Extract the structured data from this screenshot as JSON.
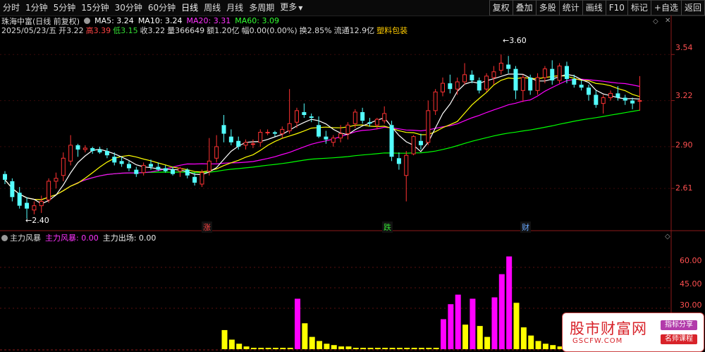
{
  "toolbar": {
    "periods": [
      "分时",
      "1分钟",
      "5分钟",
      "15分钟",
      "30分钟",
      "60分钟",
      "日线",
      "周线",
      "月线",
      "多周期",
      "更多"
    ],
    "active_period": "日线",
    "tools": [
      "复权",
      "叠加",
      "多股",
      "统计",
      "画线",
      "F10",
      "标记",
      "+自选",
      "返回"
    ]
  },
  "stock": {
    "name": "珠海中富(日线 前复权)",
    "ma5_label": "MA5: 3.24",
    "ma10_label": "MA10: 3.24",
    "ma20_label": "MA20: 3.31",
    "ma60_label": "MA60: 3.09",
    "date_label": "2025/05/23/五",
    "open": "开3.22",
    "high_lbl": "高",
    "high": "3.39",
    "low_lbl": "低",
    "low": "3.15",
    "close": "收3.22",
    "volume": "量366649",
    "amount": "额1.20亿",
    "change": "幅0.00(0.00%)",
    "turnover": "换2.85%",
    "float": "流通12.9亿",
    "sector": "塑料包装"
  },
  "price_axis": [
    "3.54",
    "3.22",
    "2.90",
    "2.61"
  ],
  "annotations": {
    "max_label": "3.60",
    "min_label": "2.40"
  },
  "markers": [
    "涨",
    "跌",
    "财"
  ],
  "indicator": {
    "name": "主力风暴",
    "storm_label": "主力风暴: 0.00",
    "exit_label": "主力出场: 0.00",
    "axis": [
      "60.00",
      "45.00",
      "30.00"
    ]
  },
  "watermark": {
    "title": "股市财富网",
    "url": "GSCFW.COM",
    "badge1": "指标分享",
    "badge2": "名师课程"
  },
  "colors": {
    "up": "#ff3232",
    "down": "#54ffff",
    "ma5": "#ffffff",
    "ma10": "#ffff00",
    "ma20": "#ff00ff",
    "ma60": "#00ff00",
    "storm": "#ff00ff",
    "exit": "#ffff00",
    "axis_text": "#ff5050"
  },
  "chart_data": {
    "type": "candlestick",
    "ylim": [
      2.4,
      3.6
    ],
    "candles": [
      {
        "o": 2.71,
        "h": 2.73,
        "l": 2.64,
        "c": 2.67
      },
      {
        "o": 2.66,
        "h": 2.68,
        "l": 2.52,
        "c": 2.55
      },
      {
        "o": 2.58,
        "h": 2.62,
        "l": 2.47,
        "c": 2.49
      },
      {
        "o": 2.51,
        "h": 2.55,
        "l": 2.4,
        "c": 2.47
      },
      {
        "o": 2.46,
        "h": 2.52,
        "l": 2.43,
        "c": 2.49
      },
      {
        "o": 2.49,
        "h": 2.56,
        "l": 2.44,
        "c": 2.52
      },
      {
        "o": 2.53,
        "h": 2.68,
        "l": 2.51,
        "c": 2.66
      },
      {
        "o": 2.66,
        "h": 2.72,
        "l": 2.61,
        "c": 2.68
      },
      {
        "o": 2.7,
        "h": 2.86,
        "l": 2.66,
        "c": 2.82
      },
      {
        "o": 2.8,
        "h": 2.98,
        "l": 2.77,
        "c": 2.91
      },
      {
        "o": 2.91,
        "h": 2.92,
        "l": 2.83,
        "c": 2.88
      },
      {
        "o": 2.88,
        "h": 2.91,
        "l": 2.86,
        "c": 2.89
      },
      {
        "o": 2.89,
        "h": 2.9,
        "l": 2.85,
        "c": 2.87
      },
      {
        "o": 2.88,
        "h": 2.9,
        "l": 2.85,
        "c": 2.86
      },
      {
        "o": 2.87,
        "h": 2.89,
        "l": 2.82,
        "c": 2.84
      },
      {
        "o": 2.83,
        "h": 2.86,
        "l": 2.77,
        "c": 2.79
      },
      {
        "o": 2.8,
        "h": 2.83,
        "l": 2.76,
        "c": 2.78
      },
      {
        "o": 2.78,
        "h": 2.8,
        "l": 2.73,
        "c": 2.75
      },
      {
        "o": 2.74,
        "h": 2.76,
        "l": 2.69,
        "c": 2.71
      },
      {
        "o": 2.72,
        "h": 2.79,
        "l": 2.7,
        "c": 2.77
      },
      {
        "o": 2.78,
        "h": 2.81,
        "l": 2.74,
        "c": 2.76
      },
      {
        "o": 2.76,
        "h": 2.79,
        "l": 2.73,
        "c": 2.74
      },
      {
        "o": 2.75,
        "h": 2.77,
        "l": 2.72,
        "c": 2.73
      },
      {
        "o": 2.74,
        "h": 2.76,
        "l": 2.7,
        "c": 2.71
      },
      {
        "o": 2.73,
        "h": 2.76,
        "l": 2.69,
        "c": 2.75
      },
      {
        "o": 2.74,
        "h": 2.75,
        "l": 2.68,
        "c": 2.7
      },
      {
        "o": 2.69,
        "h": 2.72,
        "l": 2.63,
        "c": 2.65
      },
      {
        "o": 2.64,
        "h": 2.74,
        "l": 2.62,
        "c": 2.72
      },
      {
        "o": 2.73,
        "h": 2.96,
        "l": 2.7,
        "c": 2.8
      },
      {
        "o": 2.82,
        "h": 2.98,
        "l": 2.79,
        "c": 2.9
      },
      {
        "o": 3.05,
        "h": 3.12,
        "l": 2.93,
        "c": 2.99
      },
      {
        "o": 2.97,
        "h": 3.02,
        "l": 2.91,
        "c": 2.93
      },
      {
        "o": 2.94,
        "h": 2.97,
        "l": 2.88,
        "c": 2.9
      },
      {
        "o": 2.91,
        "h": 2.95,
        "l": 2.88,
        "c": 2.93
      },
      {
        "o": 2.92,
        "h": 2.95,
        "l": 2.89,
        "c": 2.92
      },
      {
        "o": 2.93,
        "h": 3.02,
        "l": 2.9,
        "c": 3.0
      },
      {
        "o": 3.0,
        "h": 3.02,
        "l": 2.98,
        "c": 3.0
      },
      {
        "o": 3.0,
        "h": 3.01,
        "l": 2.97,
        "c": 2.99
      },
      {
        "o": 2.99,
        "h": 3.04,
        "l": 2.96,
        "c": 3.02
      },
      {
        "o": 3.01,
        "h": 3.3,
        "l": 2.99,
        "c": 3.06
      },
      {
        "o": 3.07,
        "h": 3.17,
        "l": 3.03,
        "c": 3.15
      },
      {
        "o": 3.14,
        "h": 3.2,
        "l": 3.1,
        "c": 3.12
      },
      {
        "o": 3.11,
        "h": 3.13,
        "l": 3.07,
        "c": 3.1
      },
      {
        "o": 3.05,
        "h": 3.11,
        "l": 2.96,
        "c": 2.97
      },
      {
        "o": 2.97,
        "h": 3.01,
        "l": 2.92,
        "c": 2.95
      },
      {
        "o": 2.93,
        "h": 2.98,
        "l": 2.9,
        "c": 2.96
      },
      {
        "o": 2.96,
        "h": 3.05,
        "l": 2.93,
        "c": 2.99
      },
      {
        "o": 2.99,
        "h": 3.07,
        "l": 2.95,
        "c": 3.05
      },
      {
        "o": 3.06,
        "h": 3.16,
        "l": 3.03,
        "c": 3.14
      },
      {
        "o": 3.14,
        "h": 3.17,
        "l": 3.06,
        "c": 3.08
      },
      {
        "o": 3.07,
        "h": 3.1,
        "l": 3.04,
        "c": 3.06
      },
      {
        "o": 3.05,
        "h": 3.1,
        "l": 3.02,
        "c": 3.09
      },
      {
        "o": 3.08,
        "h": 3.18,
        "l": 3.06,
        "c": 3.13
      },
      {
        "o": 3.05,
        "h": 3.08,
        "l": 2.8,
        "c": 2.83
      },
      {
        "o": 2.82,
        "h": 2.86,
        "l": 2.74,
        "c": 2.78
      },
      {
        "o": 2.7,
        "h": 2.87,
        "l": 2.52,
        "c": 2.84
      },
      {
        "o": 2.85,
        "h": 2.98,
        "l": 2.84,
        "c": 2.97
      },
      {
        "o": 2.94,
        "h": 2.99,
        "l": 2.88,
        "c": 2.91
      },
      {
        "o": 2.93,
        "h": 3.22,
        "l": 2.91,
        "c": 3.15
      },
      {
        "o": 3.15,
        "h": 3.3,
        "l": 3.12,
        "c": 3.28
      },
      {
        "o": 3.28,
        "h": 3.38,
        "l": 3.25,
        "c": 3.34
      },
      {
        "o": 3.34,
        "h": 3.4,
        "l": 3.27,
        "c": 3.3
      },
      {
        "o": 3.3,
        "h": 3.38,
        "l": 3.26,
        "c": 3.35
      },
      {
        "o": 3.35,
        "h": 3.48,
        "l": 3.33,
        "c": 3.4
      },
      {
        "o": 3.4,
        "h": 3.43,
        "l": 3.34,
        "c": 3.36
      },
      {
        "o": 3.36,
        "h": 3.38,
        "l": 3.27,
        "c": 3.29
      },
      {
        "o": 3.3,
        "h": 3.41,
        "l": 3.28,
        "c": 3.39
      },
      {
        "o": 3.38,
        "h": 3.46,
        "l": 3.33,
        "c": 3.42
      },
      {
        "o": 3.43,
        "h": 3.54,
        "l": 3.4,
        "c": 3.48
      },
      {
        "o": 3.47,
        "h": 3.53,
        "l": 3.41,
        "c": 3.44
      },
      {
        "o": 3.44,
        "h": 3.46,
        "l": 3.23,
        "c": 3.29
      },
      {
        "o": 3.29,
        "h": 3.4,
        "l": 3.21,
        "c": 3.38
      },
      {
        "o": 3.38,
        "h": 3.4,
        "l": 3.26,
        "c": 3.29
      },
      {
        "o": 3.29,
        "h": 3.41,
        "l": 3.26,
        "c": 3.38
      },
      {
        "o": 3.38,
        "h": 3.46,
        "l": 3.34,
        "c": 3.44
      },
      {
        "o": 3.44,
        "h": 3.5,
        "l": 3.33,
        "c": 3.36
      },
      {
        "o": 3.36,
        "h": 3.48,
        "l": 3.34,
        "c": 3.46
      },
      {
        "o": 3.46,
        "h": 3.49,
        "l": 3.34,
        "c": 3.37
      },
      {
        "o": 3.37,
        "h": 3.4,
        "l": 3.31,
        "c": 3.33
      },
      {
        "o": 3.33,
        "h": 3.36,
        "l": 3.29,
        "c": 3.31
      },
      {
        "o": 3.31,
        "h": 3.33,
        "l": 3.22,
        "c": 3.26
      },
      {
        "o": 3.26,
        "h": 3.29,
        "l": 3.17,
        "c": 3.19
      },
      {
        "o": 3.2,
        "h": 3.26,
        "l": 3.13,
        "c": 3.24
      },
      {
        "o": 3.24,
        "h": 3.29,
        "l": 3.22,
        "c": 3.27
      },
      {
        "o": 3.27,
        "h": 3.32,
        "l": 3.22,
        "c": 3.24
      },
      {
        "o": 3.24,
        "h": 3.26,
        "l": 3.19,
        "c": 3.22
      },
      {
        "o": 3.22,
        "h": 3.24,
        "l": 3.16,
        "c": 3.2
      },
      {
        "o": 3.22,
        "h": 3.39,
        "l": 3.15,
        "c": 3.22
      }
    ],
    "indicator": {
      "ylim": [
        0,
        75
      ],
      "storm": [
        0,
        0,
        0,
        0,
        0,
        0,
        0,
        0,
        0,
        0,
        0,
        0,
        0,
        0,
        0,
        0,
        0,
        0,
        0,
        0,
        0,
        0,
        0,
        0,
        0,
        0,
        0,
        0,
        0,
        0,
        0,
        0,
        0,
        0,
        0,
        0,
        0,
        0,
        0,
        0,
        37,
        0,
        0,
        0,
        0,
        0,
        0,
        0,
        0,
        0,
        0,
        0,
        0,
        0,
        0,
        0,
        0,
        0,
        0,
        0,
        22,
        33,
        40,
        0,
        37,
        0,
        0,
        38,
        55,
        68,
        0,
        0,
        0,
        0,
        0,
        0,
        0,
        0,
        0,
        0,
        0,
        0,
        0,
        0,
        0,
        0,
        0,
        0
      ],
      "exit": [
        0,
        0,
        0,
        0,
        0,
        0,
        0,
        0,
        0,
        0,
        0,
        0,
        0,
        0,
        0,
        0,
        0,
        0,
        0,
        0,
        0,
        0,
        0,
        0,
        0,
        0,
        0,
        0,
        0,
        0,
        14,
        7,
        4,
        2,
        1,
        1,
        1,
        1,
        1,
        1,
        0,
        19,
        9,
        6,
        4,
        3,
        2,
        2,
        1,
        1,
        1,
        1,
        1,
        1,
        1,
        1,
        1,
        1,
        1,
        1,
        0,
        0,
        0,
        18,
        0,
        17,
        9,
        0,
        0,
        0,
        34,
        16,
        10,
        6,
        4,
        3,
        2,
        1,
        1,
        0,
        0,
        0,
        0,
        0,
        0,
        0,
        0,
        0
      ]
    }
  }
}
